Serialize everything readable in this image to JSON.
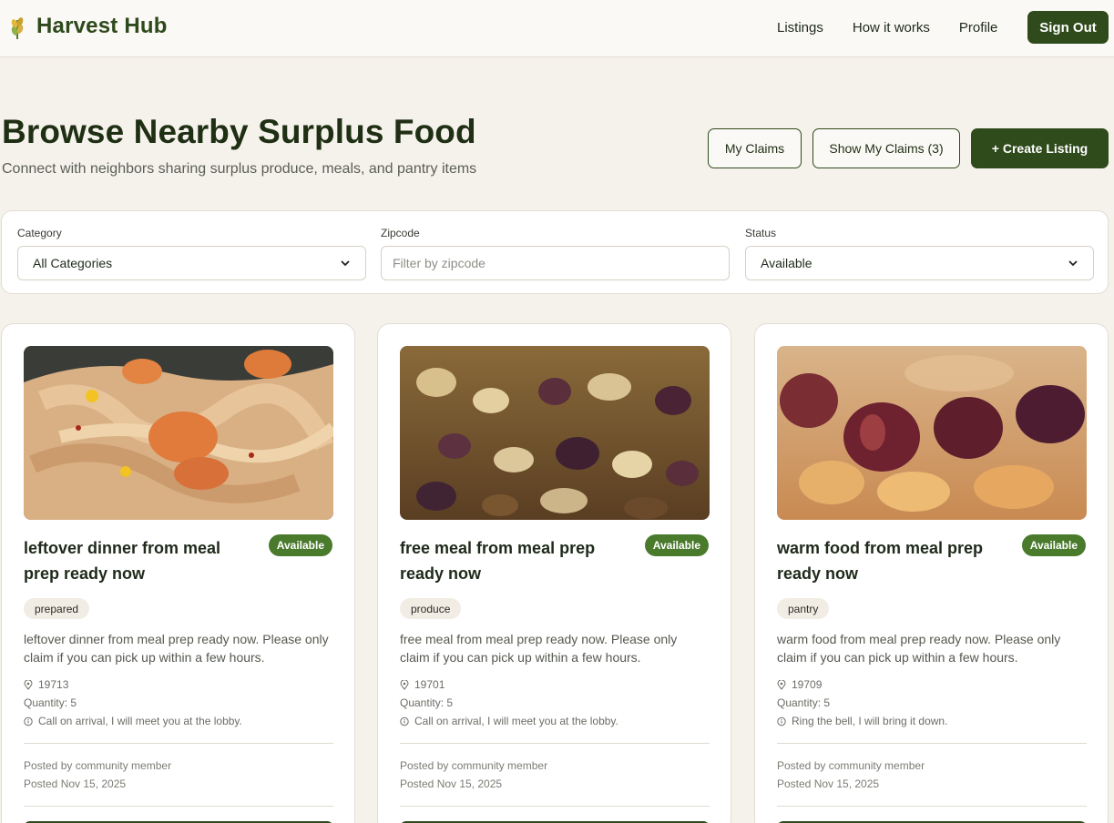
{
  "header": {
    "brand_name": "Harvest Hub",
    "nav": [
      "Listings",
      "How it works",
      "Profile"
    ],
    "sign_out": "Sign Out"
  },
  "page": {
    "title": "Browse Nearby Surplus Food",
    "subtitle": "Connect with neighbors sharing surplus produce, meals, and pantry items",
    "my_claims": "My Claims",
    "show_my_claims": "Show My Claims (3)",
    "create_listing": "+ Create Listing"
  },
  "filters": {
    "category_label": "Category",
    "category_value": "All Categories",
    "zipcode_label": "Zipcode",
    "zipcode_placeholder": "Filter by zipcode",
    "status_label": "Status",
    "status_value": "Available"
  },
  "colors": {
    "brand": "#2f4a1b",
    "badge": "#4a7a2c",
    "background": "#f5f2ec"
  },
  "listings": [
    {
      "title": "leftover dinner from meal prep ready now",
      "status": "Available",
      "category": "prepared",
      "description": "leftover dinner from meal prep ready now. Please only claim if you can pick up within a few hours.",
      "zipcode": "19713",
      "quantity": "Quantity: 5",
      "note": "Call on arrival, I will meet you at the lobby.",
      "posted_by": "Posted by community member",
      "posted_on": "Posted Nov 15, 2025",
      "image": "pasta-with-shrimp-photo"
    },
    {
      "title": "free meal from meal prep ready now",
      "status": "Available",
      "category": "produce",
      "description": "free meal from meal prep ready now. Please only claim if you can pick up within a few hours.",
      "zipcode": "19701",
      "quantity": "Quantity: 5",
      "note": "Call on arrival, I will meet you at the lobby.",
      "posted_by": "Posted by community member",
      "posted_on": "Posted Nov 15, 2025",
      "image": "mixed-nuts-photo"
    },
    {
      "title": "warm food from meal prep ready now",
      "status": "Available",
      "category": "pantry",
      "description": "warm food from meal prep ready now. Please only claim if you can pick up within a few hours.",
      "zipcode": "19709",
      "quantity": "Quantity: 5",
      "note": "Ring the bell, I will bring it down.",
      "posted_by": "Posted by community member",
      "posted_on": "Posted Nov 15, 2025",
      "image": "hazelnuts-closeup-photo"
    }
  ]
}
